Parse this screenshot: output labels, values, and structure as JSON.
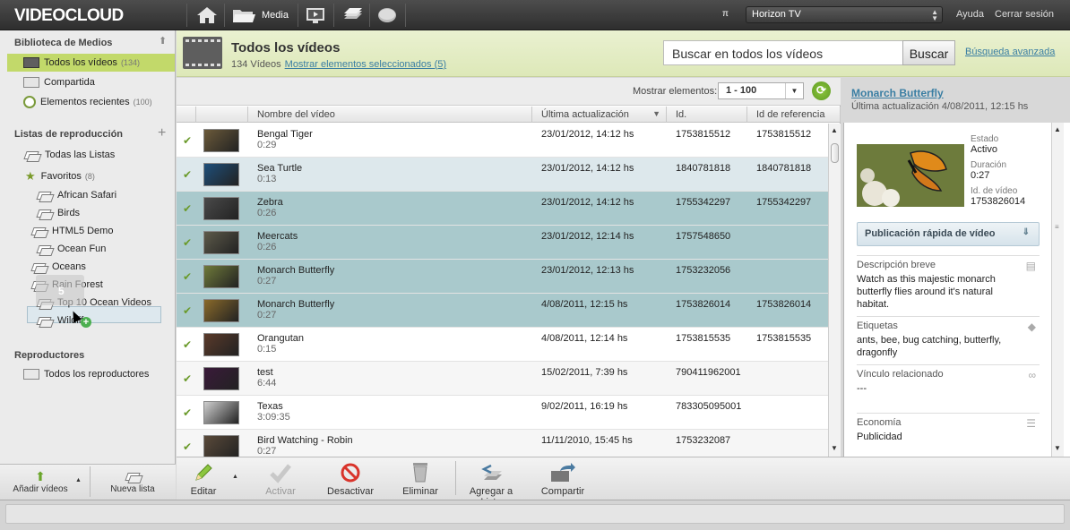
{
  "topbar": {
    "logo": "VIDEOCLOUD",
    "nav": {
      "media_label": "Media"
    },
    "account": "Horizon TV",
    "help": "Ayuda",
    "logout": "Cerrar sesión"
  },
  "sidebar": {
    "library_heading": "Biblioteca de Medios",
    "library_items": [
      {
        "label": "Todos los vídeos",
        "count": "(134)"
      },
      {
        "label": "Compartida",
        "count": ""
      },
      {
        "label": "Elementos recientes",
        "count": "(100)"
      }
    ],
    "playlists_heading": "Listas de reproducción",
    "all_lists": "Todas las Listas",
    "favorites": {
      "label": "Favoritos",
      "count": "(8)"
    },
    "playlists": [
      "African Safari",
      "Birds",
      "HTML5 Demo",
      "Ocean Fun",
      "Oceans",
      "Rain Forest",
      "Top 10 Ocean Videos",
      "Wildlife"
    ],
    "drag_count": "5",
    "players_heading": "Reproductores",
    "all_players": "Todos los reproductores",
    "add_videos": "Añadir vídeos",
    "new_list": "Nueva lista"
  },
  "header": {
    "title": "Todos los vídeos",
    "count_text": "134 Vídeos",
    "show_selected": "Mostrar elementos seleccionados (5)",
    "search_placeholder": "Buscar en todos los vídeos",
    "search_button": "Buscar",
    "advanced_search": "Búsqueda avanzada"
  },
  "grid": {
    "show_label": "Mostrar elementos:",
    "page_range": "1 - 100",
    "columns": [
      "Nombre del vídeo",
      "Última actualización",
      "Id.",
      "Id de referencia"
    ],
    "rows": [
      {
        "name": "Bengal Tiger",
        "duration": "0:29",
        "updated": "23/01/2012, 14:12 hs",
        "id": "1753815512",
        "ref": "1753815512",
        "style": "",
        "thumb_color": "#6b5a3a"
      },
      {
        "name": "Sea Turtle",
        "duration": "0:13",
        "updated": "23/01/2012, 14:12 hs",
        "id": "1840781818",
        "ref": "1840781818",
        "style": "hl1",
        "thumb_color": "#1e4f7a"
      },
      {
        "name": "Zebra",
        "duration": "0:26",
        "updated": "23/01/2012, 14:12 hs",
        "id": "1755342297",
        "ref": "1755342297",
        "style": "hl2",
        "thumb_color": "#4a4a4a"
      },
      {
        "name": "Meercats",
        "duration": "0:26",
        "updated": "23/01/2012, 12:14 hs",
        "id": "1757548650",
        "ref": "",
        "style": "hl2",
        "thumb_color": "#5d5a4a"
      },
      {
        "name": "Monarch Butterfly",
        "duration": "0:27",
        "updated": "23/01/2012, 12:13 hs",
        "id": "1753232056",
        "ref": "",
        "style": "hl2",
        "thumb_color": "#6f7a3a"
      },
      {
        "name": "Monarch Butterfly",
        "duration": "0:27",
        "updated": "4/08/2011, 12:15 hs",
        "id": "1753826014",
        "ref": "1753826014",
        "style": "hl2",
        "thumb_color": "#8a6a2a"
      },
      {
        "name": "Orangutan",
        "duration": "0:15",
        "updated": "4/08/2011, 12:14 hs",
        "id": "1753815535",
        "ref": "1753815535",
        "style": "",
        "thumb_color": "#5a3a2a"
      },
      {
        "name": "test",
        "duration": "6:44",
        "updated": "15/02/2011, 7:39 hs",
        "id": "790411962001",
        "ref": "",
        "style": "alt",
        "thumb_color": "#3a1a3a"
      },
      {
        "name": "Texas",
        "duration": "3:09:35",
        "updated": "9/02/2011, 16:19 hs",
        "id": "783305095001",
        "ref": "",
        "style": "",
        "thumb_color": "#cfcfcf"
      },
      {
        "name": "Bird Watching - Robin",
        "duration": "0:27",
        "updated": "11/11/2010, 15:45 hs",
        "id": "1753232087",
        "ref": "",
        "style": "alt",
        "thumb_color": "#5a4a3a"
      }
    ]
  },
  "toolbar": {
    "edit": "Editar",
    "activate": "Activar",
    "deactivate": "Desactivar",
    "delete": "Eliminar",
    "add_to_list": "Agregar a Lista",
    "share": "Compartir"
  },
  "detail": {
    "title": "Monarch Butterfly",
    "last_updated": "Última actualización 4/08/2011, 12:15 hs",
    "state_label": "Estado",
    "state_value": "Activo",
    "duration_label": "Duración",
    "duration_value": "0:27",
    "video_id_label": "Id. de vídeo",
    "video_id_value": "1753826014",
    "quick_publish": "Publicación rápida de vídeo",
    "short_desc_label": "Descripción breve",
    "short_desc_value": "Watch as this majestic monarch butterfly flies around it's natural habitat.",
    "tags_label": "Etiquetas",
    "tags_value": "ants, bee, bug catching, butterfly, dragonfly",
    "related_label": "Vínculo relacionado",
    "related_value": "---",
    "economy_label": "Economía",
    "economy_value": "Publicidad"
  }
}
